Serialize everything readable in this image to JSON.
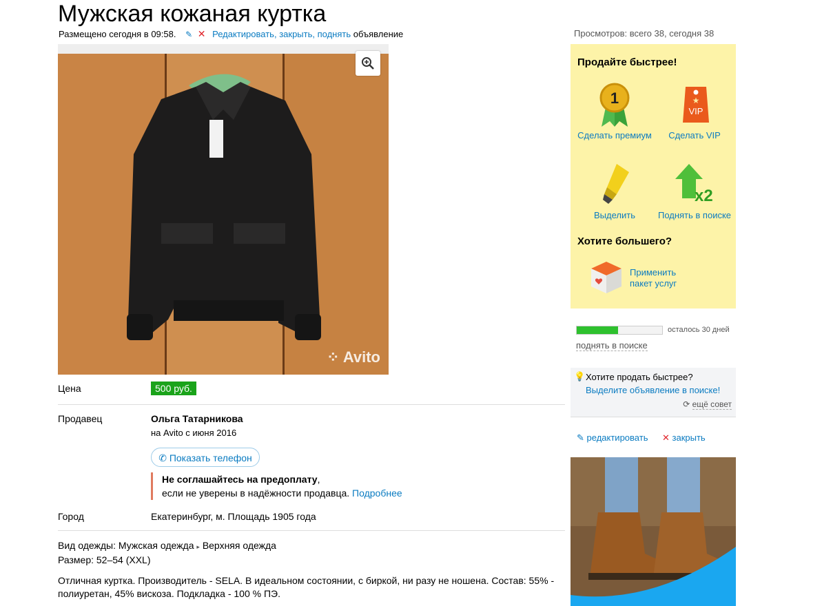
{
  "listing": {
    "title": "Мужская кожаная куртка",
    "posted": "Размещено сегодня в 09:58.",
    "actions": {
      "edit": "Редактировать",
      "close": "закрыть",
      "raise": "поднять",
      "suffix": "объявление"
    },
    "views": "Просмотров: всего 38, сегодня 38",
    "watermark": "Avito"
  },
  "details": {
    "price_label": "Цена",
    "price": "500 руб.",
    "seller_label": "Продавец",
    "seller_name": "Ольга Татарникова",
    "seller_since": "на Avito с июня 2016",
    "phone_button": "Показать телефон",
    "warning_bold": "Не соглашайтесь на предоплату",
    "warning_text": "если не уверены в надёжности продавца.",
    "warning_link": "Подробнее",
    "city_label": "Город",
    "city": "Екатеринбург, м. Площадь 1905 года",
    "category_prefix": "Вид одежды: Мужская одежда",
    "category_sub": "Верхняя одежда",
    "size": "Размер: 52–54 (XXL)",
    "description": "Отличная куртка. Производитель - SELA. В идеальном состоянии, с биркой, ни разу не ношена. Состав: 55% - полиуретан, 45% вискоза. Подкладка - 100 % ПЭ."
  },
  "sidebar": {
    "sell_faster": "Продайте быстрее!",
    "premium": "Сделать премиум",
    "vip": "Сделать VIP",
    "vip_badge": "VIP",
    "premium_badge": "1",
    "highlight": "Выделить",
    "raise_search": "Поднять в поиске",
    "raise_mult": "x2",
    "want_more": "Хотите большего?",
    "package": [
      "Применить",
      "пакет услуг"
    ],
    "progress": 0.48,
    "days_left": "осталось 30 дней",
    "raise_link": "поднять в поиске",
    "tip_question": "Хотите продать быстрее?",
    "tip_link": "Выделите объявление в поиске!",
    "tip_more": "ещё совет",
    "edit": "редактировать",
    "close": "закрыть"
  },
  "colors": {
    "accent": "#0a7bc1",
    "price_bg": "#1aa31a",
    "sell_box": "#fdf3a8",
    "progress": "#2ec12e"
  }
}
